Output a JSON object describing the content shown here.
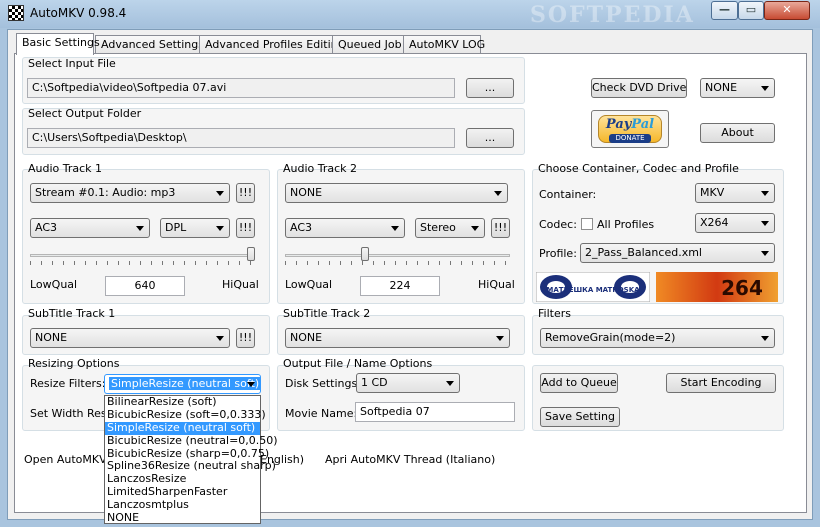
{
  "window": {
    "title": "AutoMKV 0.98.4",
    "watermark": "SOFTPEDIA",
    "minimize_glyph": "—",
    "maximize_glyph": "▭",
    "close_glyph": "✕"
  },
  "tabs": [
    {
      "label": "Basic Settings",
      "active": true
    },
    {
      "label": "Advanced Settings"
    },
    {
      "label": "Advanced Profiles Editing"
    },
    {
      "label": "Queued Job"
    },
    {
      "label": "AutoMKV LOG"
    }
  ],
  "input_file": {
    "label": "Select Input File",
    "value": "C:\\Softpedia\\video\\Softpedia 07.avi",
    "browse": "..."
  },
  "output_folder": {
    "label": "Select Output Folder",
    "value": "C:\\Users\\Softpedia\\Desktop\\",
    "browse": "..."
  },
  "top_right": {
    "check_dvd": "Check DVD Drive",
    "dvd_select": "NONE",
    "about": "About",
    "paypal_a": "Pay",
    "paypal_b": "Pal",
    "donate": "DONATE"
  },
  "audio1": {
    "label": "Audio Track 1",
    "stream": "Stream #0.1: Audio: mp3",
    "excl": "!!!",
    "codec": "AC3",
    "channels": "DPL",
    "excl2": "!!!",
    "low": "LowQual",
    "high": "HiQual",
    "bitrate": "640",
    "slider_fraction": 1.0
  },
  "audio2": {
    "label": "Audio Track 2",
    "stream": "NONE",
    "excl": "!!!",
    "codec": "AC3",
    "channels": "Stereo",
    "excl2": "!!!",
    "low": "LowQual",
    "high": "HiQual",
    "bitrate": "224",
    "slider_fraction": 0.35
  },
  "container": {
    "label": "Choose Container, Codec and Profile",
    "container_label": "Container:",
    "container_value": "MKV",
    "codec_label": "Codec:",
    "all_profiles": "All Profiles",
    "codec_value": "X264",
    "profile_label": "Profile:",
    "profile_value": "2_Pass_Balanced.xml",
    "logo_matroska": "МАТРЁШКА MATROSKA",
    "logo_264": "264"
  },
  "subtitle1": {
    "label": "SubTitle Track 1",
    "value": "NONE",
    "excl": "!!!"
  },
  "subtitle2": {
    "label": "SubTitle Track 2",
    "value": "NONE"
  },
  "filters": {
    "label": "Filters",
    "value": "RemoveGrain(mode=2)"
  },
  "resizing": {
    "label": "Resizing Options",
    "filters_label": "Resize Filters:",
    "selected": "SimpleResize (neutral soft)",
    "width_label": "Set Width Reso",
    "options": [
      "BilinearResize (soft)",
      "BicubicResize (soft=0,0.333)",
      "SimpleResize (neutral soft)",
      "BicubicResize (neutral=0,0.50)",
      "BicubicResize (sharp=0,0.75)",
      "Spline36Resize (neutral sharp)",
      "LanczosResize",
      "LimitedSharpenFaster",
      "Lanczosmtplus",
      "NONE"
    ],
    "selected_index": 2
  },
  "output_options": {
    "label": "Output File / Name Options",
    "disk_label": "Disk Settings:",
    "disk_value": "1 CD",
    "movie_label": "Movie Name:",
    "movie_value": "Softpedia 07"
  },
  "actions": {
    "add_queue": "Add to Queue",
    "start": "Start Encoding",
    "save": "Save Setting"
  },
  "threads": {
    "open_en_prefix": "Open AutoMKV W",
    "open_en_suffix": "English)",
    "open_it": "Apri AutoMKV Thread (Italiano)"
  }
}
